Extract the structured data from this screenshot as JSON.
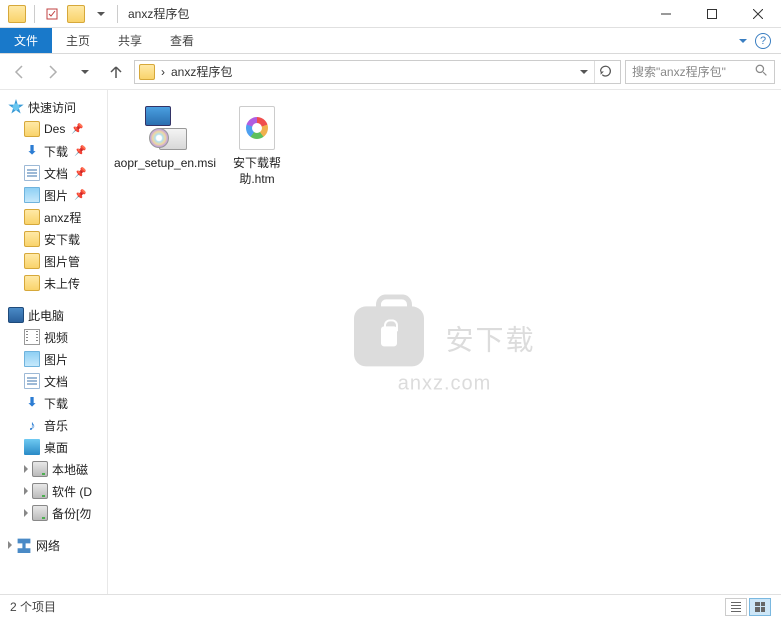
{
  "window": {
    "title": "anxz程序包"
  },
  "ribbon": {
    "file": "文件",
    "home": "主页",
    "share": "共享",
    "view": "查看"
  },
  "address": {
    "crumb_sep": "›",
    "path": "anxz程序包"
  },
  "search": {
    "placeholder": "搜索\"anxz程序包\""
  },
  "tree": {
    "quick_access": "快速访问",
    "desktop": "Des",
    "downloads": "下载",
    "documents": "文档",
    "pictures": "图片",
    "anxz": "anxz程",
    "axz_dl": "安下载",
    "picmgr": "图片管",
    "unup": "未上传",
    "this_pc": "此电脑",
    "videos": "视频",
    "pictures2": "图片",
    "documents2": "文档",
    "downloads2": "下载",
    "music": "音乐",
    "desktop2": "桌面",
    "local_disk": "本地磁",
    "software": "软件 (D",
    "backup": "备份[勿",
    "network": "网络"
  },
  "files": [
    {
      "name": "aopr_setup_en.msi",
      "type": "msi"
    },
    {
      "name": "安下载帮助.htm",
      "type": "htm"
    }
  ],
  "watermark": {
    "brand": "安下载",
    "domain": "anxz.com"
  },
  "status": {
    "count": "2 个项目"
  }
}
